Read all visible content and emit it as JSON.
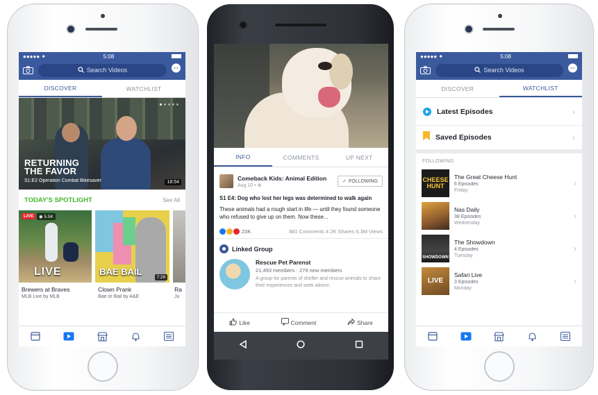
{
  "status": {
    "carrier": "●●●●● ✦",
    "time": "5:08"
  },
  "search": {
    "placeholder": "Search Videos"
  },
  "tabs": {
    "discover": "DISCOVER",
    "watchlist": "WATCHLIST"
  },
  "hero": {
    "title_line1": "RETURNING",
    "title_line2": "THE FAVOR",
    "subtitle": "S1:E2 Operation Combat Bikesaver",
    "duration": "18:54"
  },
  "spotlight": {
    "heading": "TODAY'S SPOTLIGHT",
    "see_all": "See All",
    "cards": [
      {
        "live_badge": "LIVE",
        "viewers": "5.5K",
        "overlay": "LIVE",
        "title": "Brewers at Braves",
        "meta": "MLB Live by MLB"
      },
      {
        "overlay": "BAE BAIL",
        "duration": "7:28",
        "title": "Clown Prank",
        "meta": "Bae or Bail by A&E"
      },
      {
        "title": "Ra",
        "meta": "Ju"
      }
    ]
  },
  "android": {
    "tabs": {
      "info": "INFO",
      "comments": "COMMENTS",
      "upnext": "UP NEXT"
    },
    "post": {
      "page_name": "Comeback Kids: Animal Edition",
      "date": "Aug 10 • ⊕",
      "follow_label": "FOLLOWING",
      "headline": "S1 E4: Dog who lost her legs was determined to walk again",
      "body": "These animals had a rough start in life — until they found someone who refused to give up on them. Now these...",
      "reactions": "23K",
      "stats": "881 Comments  4.2K Shares  6.3M Views"
    },
    "linked": {
      "heading": "Linked Group",
      "group_name": "Rescue Pet Parenst",
      "members": "21,493 members · 279 new members",
      "desc": "A group for parents of shelter and rescue animals to share their experiences and seek advice."
    },
    "actions": {
      "like": "Like",
      "comment": "Comment",
      "share": "Share"
    }
  },
  "watchlist": {
    "latest": "Latest Episodes",
    "saved": "Saved Episodes",
    "following_label": "FOLLOWING",
    "shows": [
      {
        "title": "The Great Cheese Hunt",
        "episodes": "6 Episodes",
        "day": "Friday",
        "thumb": "CHEESE HUNT"
      },
      {
        "title": "Nas Daily",
        "episodes": "38 Episodes",
        "day": "Wednesday",
        "thumb": ""
      },
      {
        "title": "The Showdown",
        "episodes": "4 Episodes",
        "day": "Tuesday",
        "thumb": "SHOWDOWN"
      },
      {
        "title": "Safari Live",
        "episodes": "3 Episodes",
        "day": "Monday",
        "thumb": "LIVE"
      }
    ]
  },
  "colors": {
    "fb_blue": "#3b5a9e",
    "spotlight_green": "#42b72a",
    "live_red": "#e4252c",
    "video_blue": "#1877f2"
  }
}
